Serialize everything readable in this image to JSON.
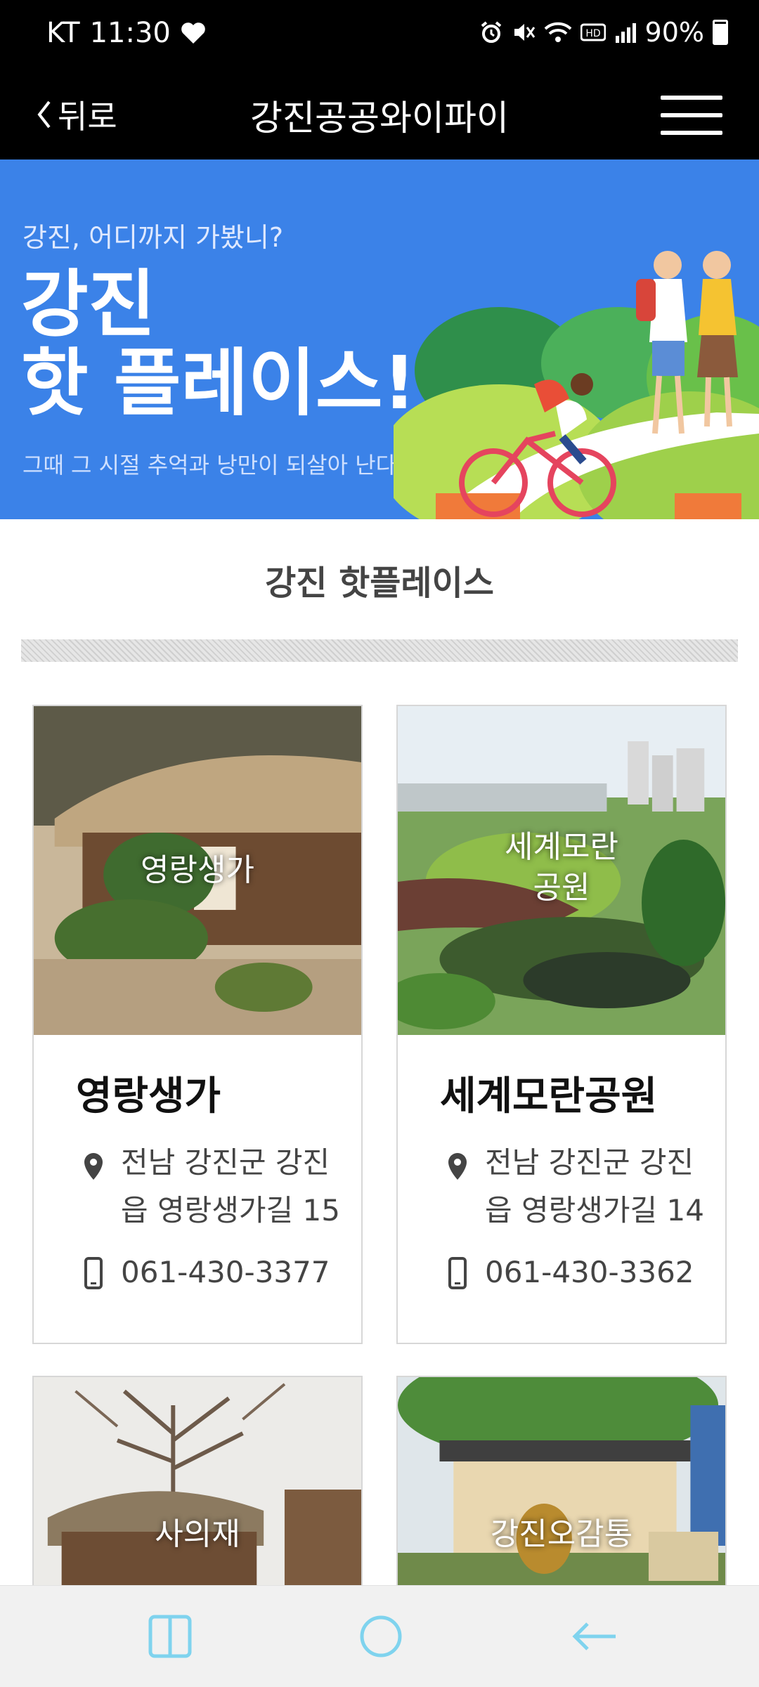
{
  "status": {
    "carrier": "KT",
    "time": "11:30",
    "battery": "90%",
    "icons": [
      "heart-icon",
      "alarm-icon",
      "mute-icon",
      "wifi-icon",
      "hd-icon",
      "signal-icon",
      "battery-icon"
    ]
  },
  "nav": {
    "back_label": "뒤로",
    "title": "강진공공와이파이",
    "menu_icon": "menu-icon"
  },
  "banner": {
    "subtitle": "강진, 어디까지 가봤니?",
    "headline_line1": "강진",
    "headline_line2": "핫 플레이스!",
    "description": "그때 그 시절 추억과 낭만이 되살아 난다."
  },
  "section": {
    "title": "강진 핫플레이스"
  },
  "places": [
    {
      "photo_label": "영랑생가",
      "name": "영랑생가",
      "address": "전남 강진군 강진읍 영랑생가길 15",
      "phone": "061-430-3377"
    },
    {
      "photo_label_1": "세계모란",
      "photo_label_2": "공원",
      "name": "세계모란공원",
      "address": "전남 강진군 강진읍 영랑생가길 14",
      "phone": "061-430-3362"
    },
    {
      "photo_label": "사의재"
    },
    {
      "photo_label": "강진오감통"
    }
  ],
  "colors": {
    "banner_bg": "#3b82e8",
    "topbar_bg": "#000000",
    "card_border": "#d7d7d7",
    "nav_icon": "#7fd3ee"
  },
  "bottom_nav": {
    "icons": [
      "recent-apps-icon",
      "home-icon",
      "back-arrow-icon"
    ]
  }
}
